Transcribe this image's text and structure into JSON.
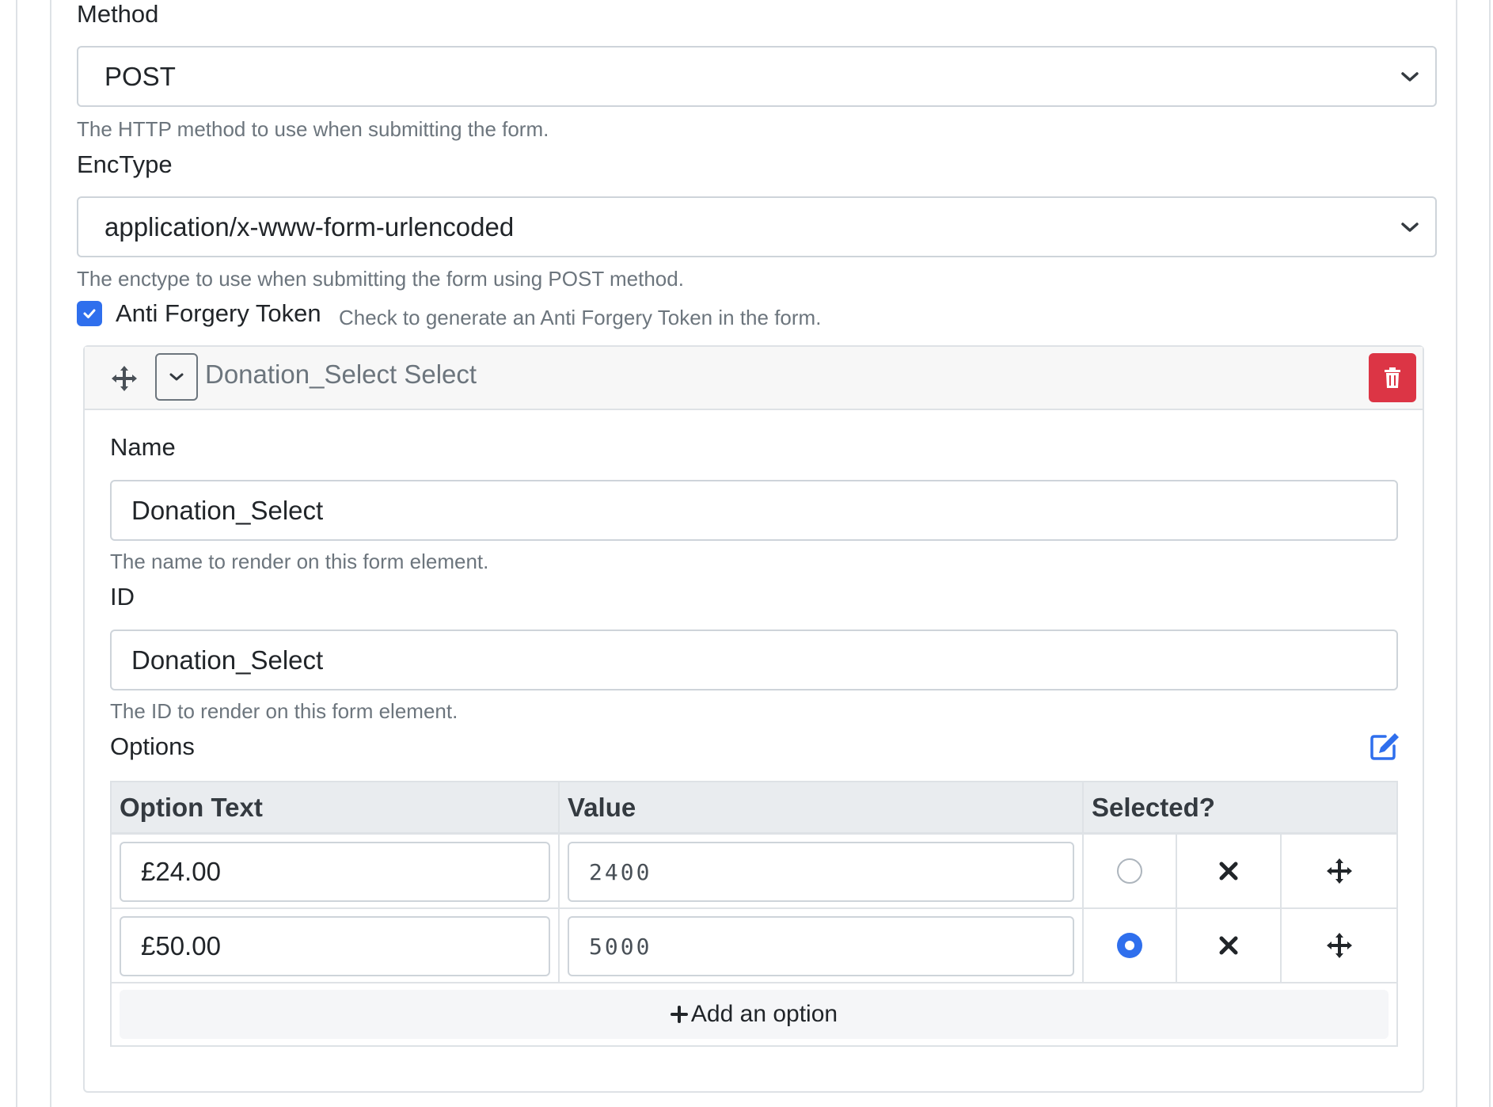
{
  "form": {
    "method": {
      "label": "Method",
      "value": "POST",
      "help": "The HTTP method to use when submitting the form."
    },
    "enctype": {
      "label": "EncType",
      "value": "application/x-www-form-urlencoded",
      "help": "The enctype to use when submitting the form using POST method."
    },
    "anti_forgery": {
      "label": "Anti Forgery Token",
      "help": "Check to generate an Anti Forgery Token in the form.",
      "checked": true
    }
  },
  "element": {
    "title": "Donation_Select Select",
    "name": {
      "label": "Name",
      "value": "Donation_Select",
      "help": "The name to render on this form element."
    },
    "id": {
      "label": "ID",
      "value": "Donation_Select",
      "help": "The ID to render on this form element."
    },
    "options": {
      "label": "Options",
      "headers": {
        "text": "Option Text",
        "value": "Value",
        "selected": "Selected?"
      },
      "rows": [
        {
          "text": "£24.00",
          "value": "2400",
          "selected": false
        },
        {
          "text": "£50.00",
          "value": "5000",
          "selected": true
        }
      ],
      "add_label": "Add an option"
    }
  },
  "colors": {
    "accent": "#2f6fed",
    "danger": "#dc3545",
    "muted": "#6c757d"
  },
  "icons": [
    "move-icon",
    "chevron-down-icon",
    "trash-icon",
    "edit-icon",
    "close-icon",
    "plus-icon",
    "check-icon"
  ]
}
